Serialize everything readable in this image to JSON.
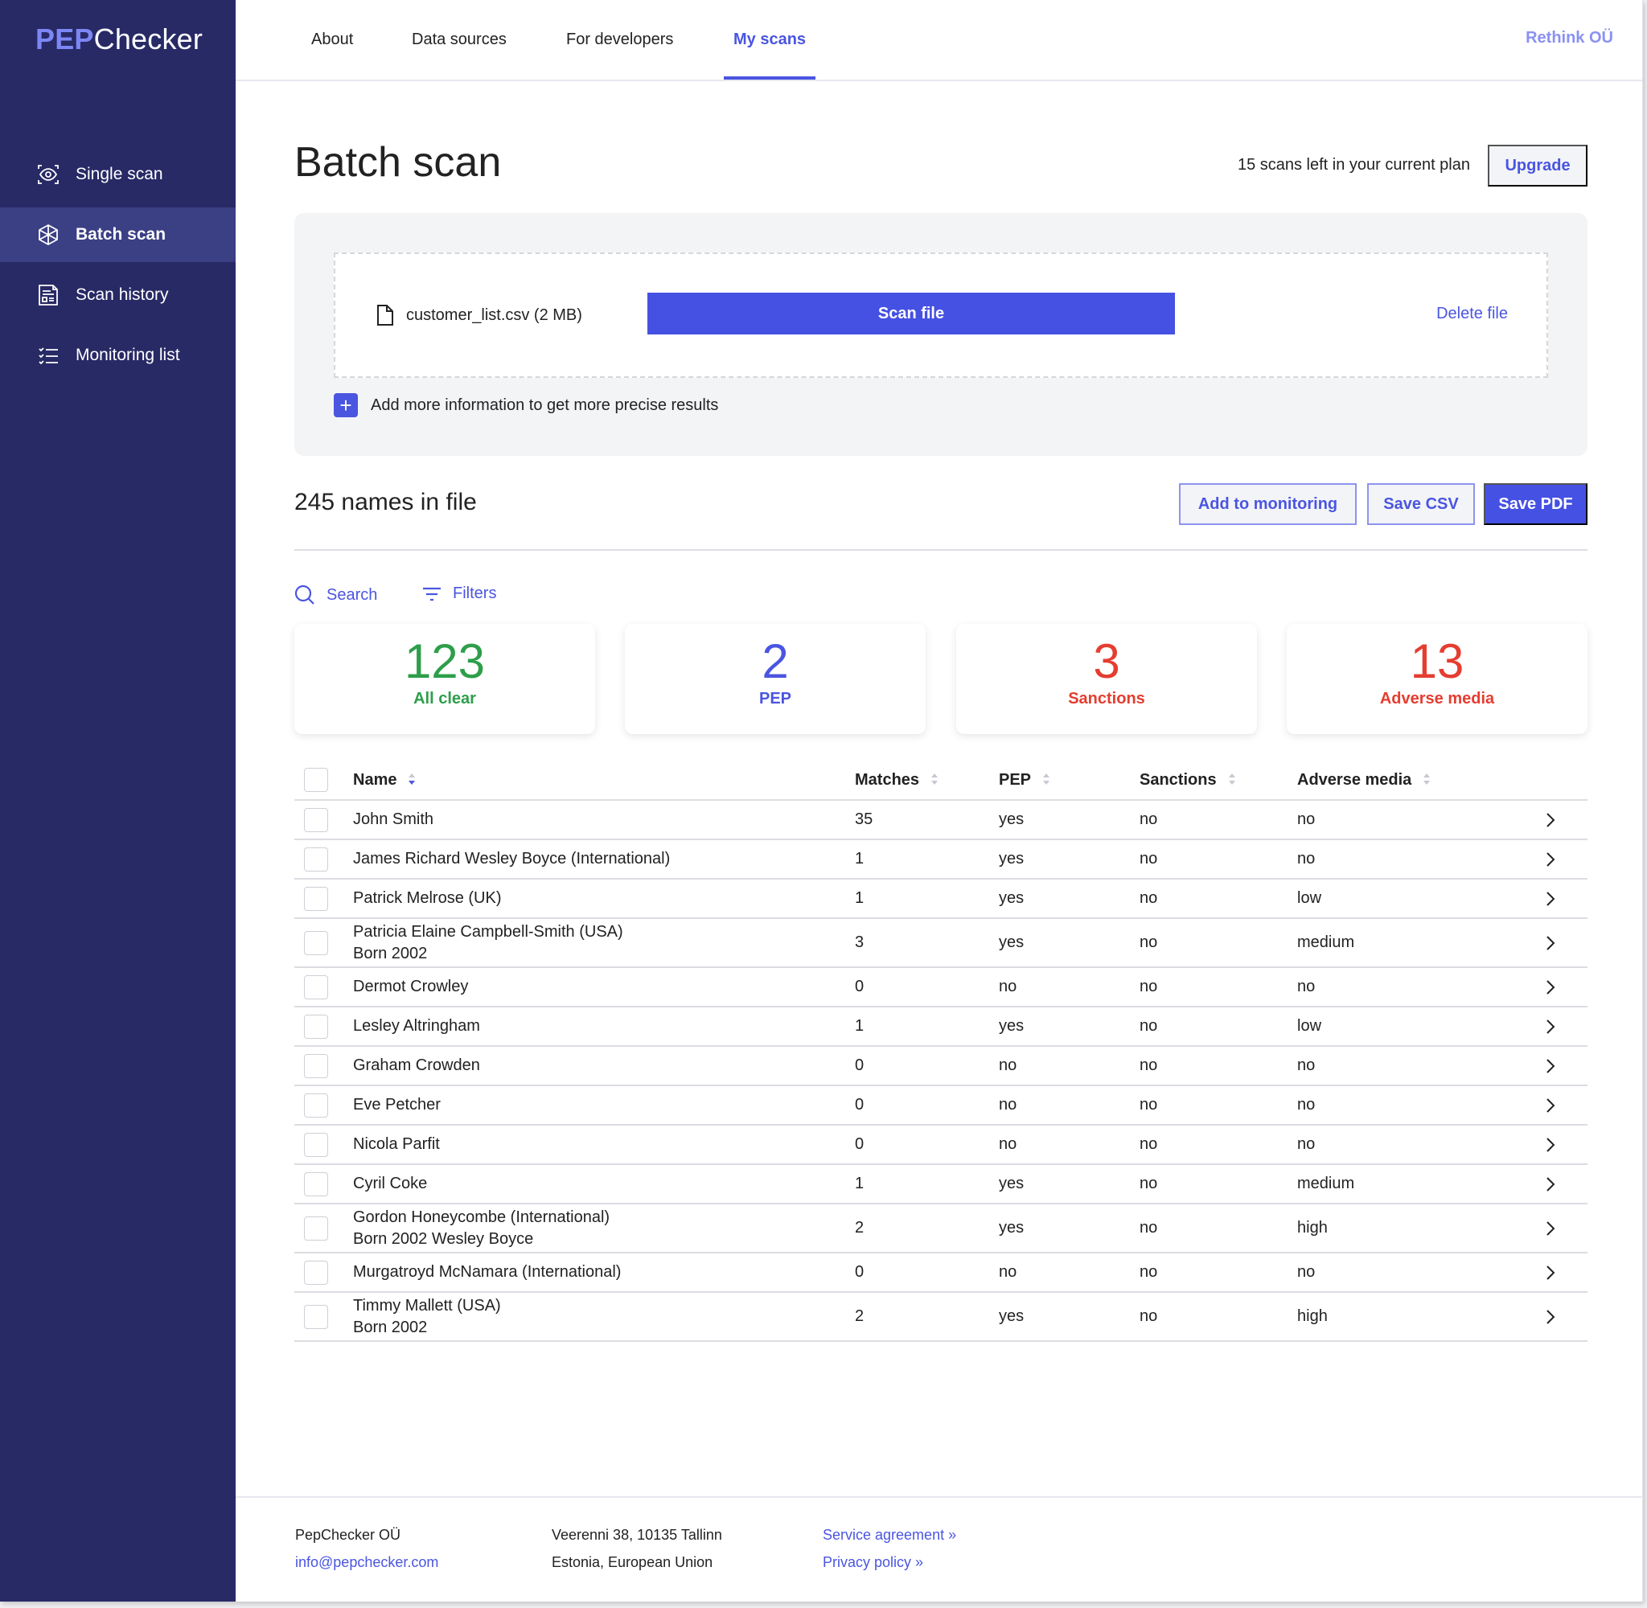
{
  "brand": {
    "prefix": "PEP",
    "suffix": "Checker"
  },
  "sidebar": {
    "items": [
      {
        "label": "Single scan",
        "icon": "eye-scan-icon",
        "active": false
      },
      {
        "label": "Batch scan",
        "icon": "batch-hexagon-icon",
        "active": true
      },
      {
        "label": "Scan history",
        "icon": "document-list-icon",
        "active": false
      },
      {
        "label": "Monitoring list",
        "icon": "checklist-icon",
        "active": false
      }
    ]
  },
  "topnav": {
    "tabs": [
      {
        "label": "About",
        "active": false
      },
      {
        "label": "Data sources",
        "active": false
      },
      {
        "label": "For developers",
        "active": false
      },
      {
        "label": "My scans",
        "active": true
      }
    ],
    "organization": "Rethink OÜ"
  },
  "page": {
    "title": "Batch scan",
    "plan_text": "15 scans left in your current plan",
    "upgrade_label": "Upgrade"
  },
  "upload": {
    "file_name": "customer_list.csv (2 MB)",
    "scan_label": "Scan file",
    "delete_label": "Delete file",
    "add_more_label": "Add more information to get more precise results"
  },
  "results": {
    "count_label": "245 names in file",
    "add_monitoring_label": "Add to monitoring",
    "save_csv_label": "Save CSV",
    "save_pdf_label": "Save PDF",
    "search_label": "Search",
    "filters_label": "Filters"
  },
  "summary": [
    {
      "value": "123",
      "label": "All clear",
      "color": "#2e9e4a"
    },
    {
      "value": "2",
      "label": "PEP",
      "color": "#4a55e0"
    },
    {
      "value": "3",
      "label": "Sanctions",
      "color": "#e53d30"
    },
    {
      "value": "13",
      "label": "Adverse media",
      "color": "#e53d30"
    }
  ],
  "table": {
    "columns": [
      "Name",
      "Matches",
      "PEP",
      "Sanctions",
      "Adverse media"
    ],
    "rows": [
      {
        "name": "John Smith",
        "sub": "",
        "matches": "35",
        "pep": "yes",
        "sanctions": "no",
        "adverse": "no"
      },
      {
        "name": "James Richard Wesley Boyce (International)",
        "sub": "",
        "matches": "1",
        "pep": "yes",
        "sanctions": "no",
        "adverse": "no"
      },
      {
        "name": "Patrick Melrose (UK)",
        "sub": "",
        "matches": "1",
        "pep": "yes",
        "sanctions": "no",
        "adverse": "low"
      },
      {
        "name": "Patricia Elaine Campbell-Smith (USA)",
        "sub": "Born 2002",
        "matches": "3",
        "pep": "yes",
        "sanctions": "no",
        "adverse": "medium"
      },
      {
        "name": "Dermot Crowley",
        "sub": "",
        "matches": "0",
        "pep": "no",
        "sanctions": "no",
        "adverse": "no"
      },
      {
        "name": "Lesley Altringham",
        "sub": "",
        "matches": "1",
        "pep": "yes",
        "sanctions": "no",
        "adverse": "low"
      },
      {
        "name": "Graham Crowden",
        "sub": "",
        "matches": "0",
        "pep": "no",
        "sanctions": "no",
        "adverse": "no"
      },
      {
        "name": "Eve Petcher",
        "sub": "",
        "matches": "0",
        "pep": "no",
        "sanctions": "no",
        "adverse": "no"
      },
      {
        "name": "Nicola Parfit",
        "sub": "",
        "matches": "0",
        "pep": "no",
        "sanctions": "no",
        "adverse": "no"
      },
      {
        "name": "Cyril Coke",
        "sub": "",
        "matches": "1",
        "pep": "yes",
        "sanctions": "no",
        "adverse": "medium"
      },
      {
        "name": "Gordon Honeycombe  (International)",
        "sub": "Born 2002 Wesley Boyce",
        "matches": "2",
        "pep": "yes",
        "sanctions": "no",
        "adverse": "high"
      },
      {
        "name": "Murgatroyd McNamara (International)",
        "sub": "",
        "matches": "0",
        "pep": "no",
        "sanctions": "no",
        "adverse": "no"
      },
      {
        "name": "Timmy Mallett (USA)",
        "sub": "Born 2002",
        "matches": "2",
        "pep": "yes",
        "sanctions": "no",
        "adverse": "high"
      }
    ]
  },
  "footer": {
    "company": "PepChecker OÜ",
    "email": "info@pepchecker.com",
    "address_line1": "Veerenni 38, 10135 Tallinn",
    "address_line2": "Estonia, European Union",
    "service_agreement": "Service agreement »",
    "privacy_policy": "Privacy policy »"
  },
  "colors": {
    "sidebar_bg": "#282a66",
    "accent": "#4551e3",
    "green": "#2e9e4a",
    "red": "#e53d30"
  }
}
